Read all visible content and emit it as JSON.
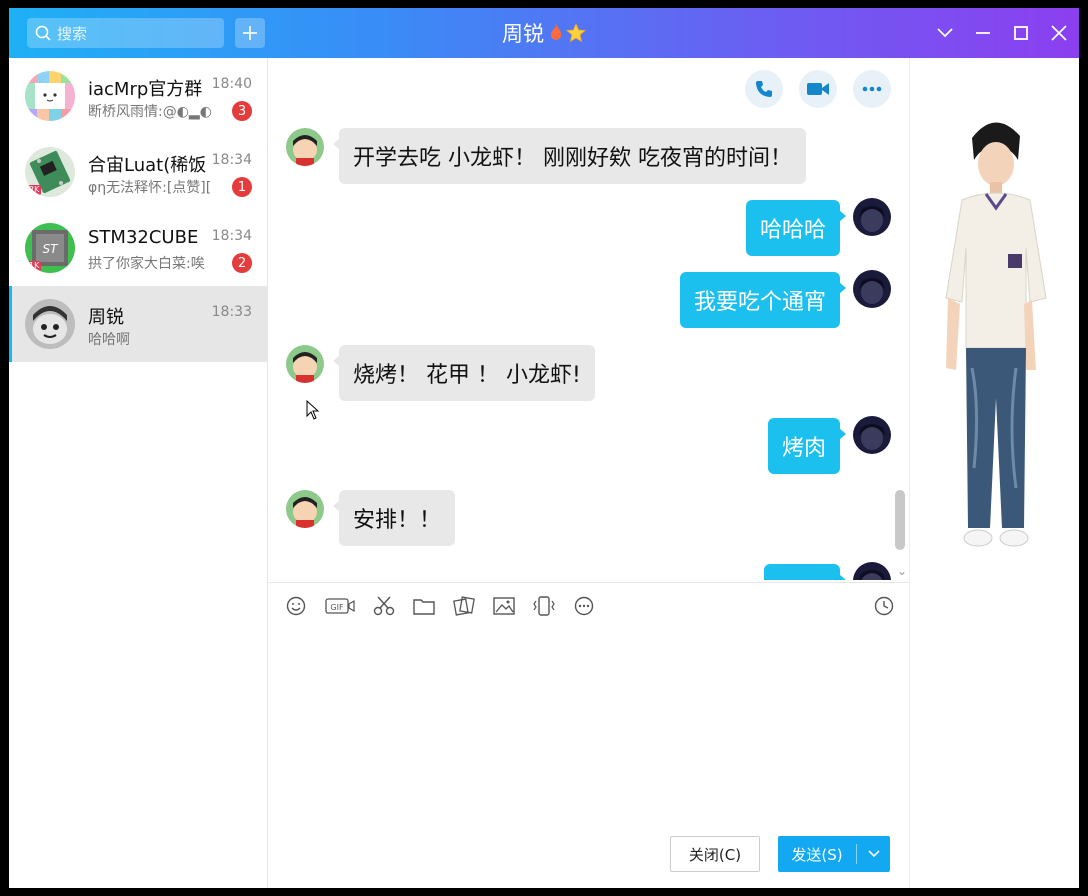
{
  "search": {
    "placeholder": "搜索"
  },
  "title": {
    "name": "周锐"
  },
  "conversations": [
    {
      "name": "iacMrp官方群",
      "time": "18:40",
      "preview": "断桥风雨情:@◐▂◐",
      "badge": "3"
    },
    {
      "name": "合宙Luat(稀饭",
      "time": "18:34",
      "preview": "φη无法释怀:[点赞][",
      "badge": "1",
      "tag": "2K"
    },
    {
      "name": "STM32CUBE",
      "time": "18:34",
      "preview": "拱了你家大白菜:唉",
      "badge": "2",
      "tag": "1K"
    },
    {
      "name": "周锐",
      "time": "18:33",
      "preview": "哈哈啊",
      "badge": ""
    }
  ],
  "messages": [
    {
      "side": "in",
      "text": "开学去吃 小龙虾！ 刚刚好欸 吃夜宵的时间！"
    },
    {
      "side": "out",
      "text": "哈哈哈"
    },
    {
      "side": "out",
      "text": "我要吃个通宵"
    },
    {
      "side": "in",
      "text": "烧烤！ 花甲 ！ 小龙虾!"
    },
    {
      "side": "out",
      "text": "烤肉"
    },
    {
      "side": "in",
      "text": "安排！！"
    },
    {
      "side": "out",
      "text": ""
    }
  ],
  "toolbar": {
    "icons": [
      "emoji-icon",
      "gif-icon",
      "scissors-icon",
      "folder-icon",
      "image-gallery-icon",
      "image-icon",
      "shake-icon",
      "more-icon"
    ],
    "gif_label": "GIF"
  },
  "buttons": {
    "close": "关闭(C)",
    "send": "发送(S)"
  },
  "colors": {
    "accent": "#12b7f5",
    "bubble_out": "#1cc0ee",
    "badge": "#e43b3b"
  }
}
